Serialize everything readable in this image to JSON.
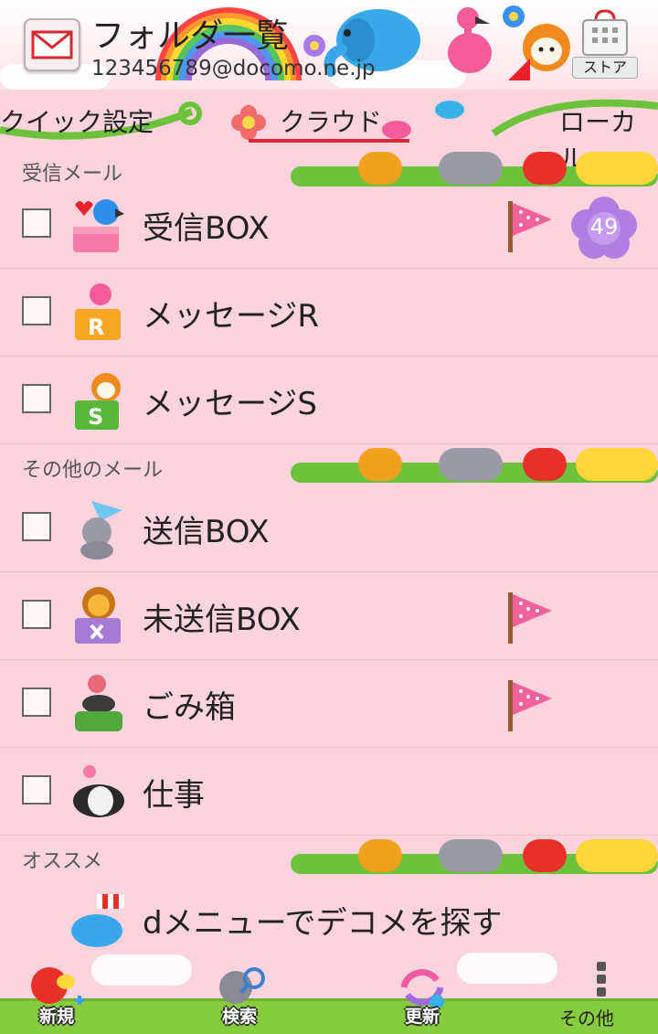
{
  "header": {
    "title": "フォルダ一覧",
    "account": "123456789@docomo.ne.jp",
    "store_label": "ストア"
  },
  "tabs": [
    {
      "label": "クイック設定",
      "active": false
    },
    {
      "label": "クラウド",
      "active": true
    },
    {
      "label": "ローカル",
      "active": false
    }
  ],
  "sections": {
    "inbox": "受信メール",
    "other": "その他のメール",
    "recommend": "オススメ"
  },
  "folders": [
    {
      "label": "受信BOX",
      "flag": true,
      "badge": "49"
    },
    {
      "label": "メッセージR",
      "flag": false
    },
    {
      "label": "メッセージS",
      "flag": false
    },
    {
      "label": "送信BOX",
      "flag": false
    },
    {
      "label": "未送信BOX",
      "flag": true
    },
    {
      "label": "ごみ箱",
      "flag": true
    },
    {
      "label": "仕事",
      "flag": false
    }
  ],
  "recommend": {
    "label": "dメニューでデコメを探す"
  },
  "bottom_bar": {
    "new_label": "新規",
    "search_label": "検索",
    "refresh_label": "更新",
    "other_label": "その他"
  },
  "colors": {
    "background": "#fbd3dd",
    "accent": "#e0283a",
    "badge": "#b07ee0",
    "flag": "#f0609a",
    "grass": "#86cc3e"
  }
}
